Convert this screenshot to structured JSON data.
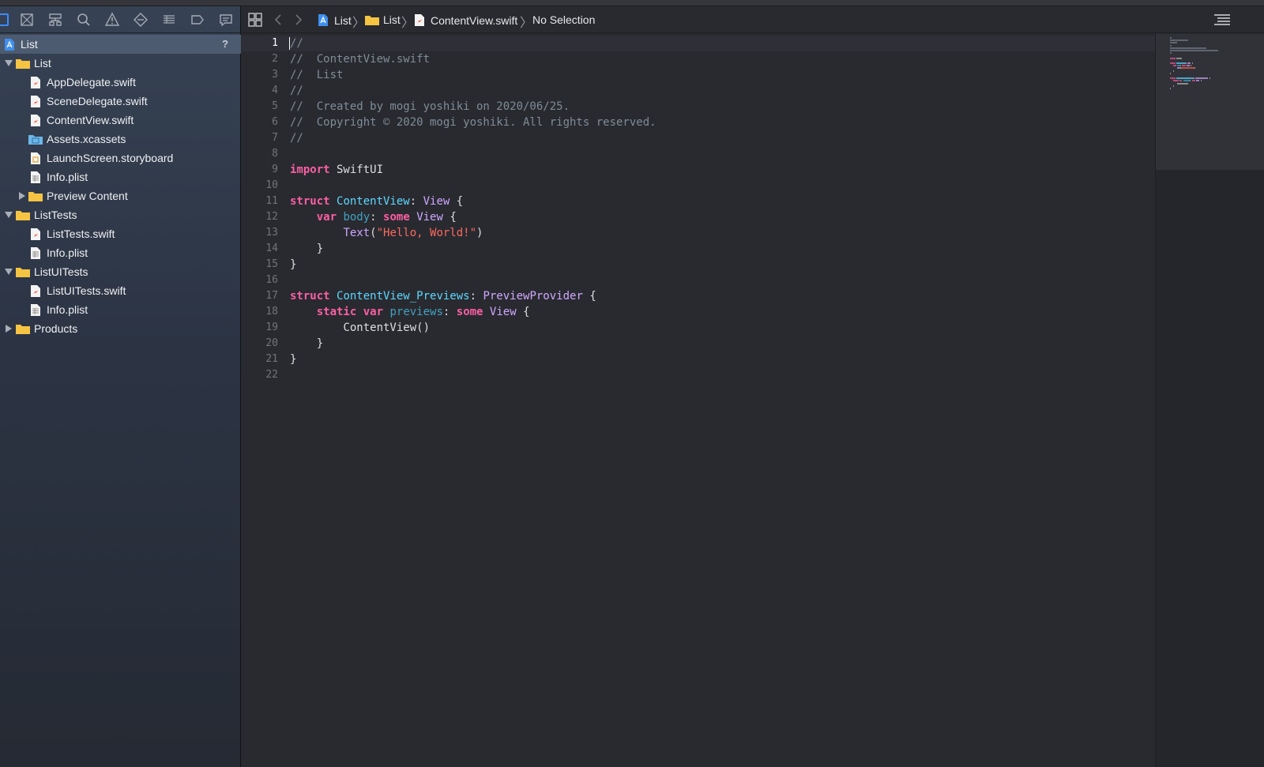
{
  "navigator": {
    "toolbar_icons": [
      "project-navigator-icon",
      "source-control-icon",
      "symbol-navigator-icon",
      "find-navigator-icon",
      "issue-navigator-icon",
      "test-navigator-icon",
      "debug-navigator-icon",
      "breakpoint-navigator-icon",
      "report-navigator-icon"
    ],
    "root": {
      "label": "List",
      "badge": "?"
    },
    "tree": [
      {
        "label": "List",
        "kind": "folder",
        "expanded": true
      },
      {
        "label": "AppDelegate.swift",
        "kind": "swift"
      },
      {
        "label": "SceneDelegate.swift",
        "kind": "swift"
      },
      {
        "label": "ContentView.swift",
        "kind": "swift"
      },
      {
        "label": "Assets.xcassets",
        "kind": "assets"
      },
      {
        "label": "LaunchScreen.storyboard",
        "kind": "storyboard"
      },
      {
        "label": "Info.plist",
        "kind": "plist"
      },
      {
        "label": "Preview Content",
        "kind": "folder",
        "expanded": false
      },
      {
        "label": "ListTests",
        "kind": "folder",
        "expanded": true
      },
      {
        "label": "ListTests.swift",
        "kind": "swift"
      },
      {
        "label": "Info.plist",
        "kind": "plist"
      },
      {
        "label": "ListUITests",
        "kind": "folder",
        "expanded": true
      },
      {
        "label": "ListUITests.swift",
        "kind": "swift"
      },
      {
        "label": "Info.plist",
        "kind": "plist"
      },
      {
        "label": "Products",
        "kind": "folder",
        "expanded": false
      }
    ]
  },
  "jumpbar": {
    "crumbs": [
      "List",
      "List",
      "ContentView.swift",
      "No Selection"
    ]
  },
  "editor": {
    "current_line": 1,
    "lines": [
      [
        [
          "comment",
          "//"
        ]
      ],
      [
        [
          "comment",
          "//  ContentView.swift"
        ]
      ],
      [
        [
          "comment",
          "//  List"
        ]
      ],
      [
        [
          "comment",
          "//"
        ]
      ],
      [
        [
          "comment",
          "//  Created by mogi yoshiki on 2020/06/25."
        ]
      ],
      [
        [
          "comment",
          "//  Copyright © 2020 mogi yoshiki. All rights reserved."
        ]
      ],
      [
        [
          "comment",
          "//"
        ]
      ],
      [],
      [
        [
          "kw",
          "import"
        ],
        [
          "plain",
          " SwiftUI"
        ]
      ],
      [],
      [
        [
          "kw",
          "struct"
        ],
        [
          "plain",
          " "
        ],
        [
          "decl",
          "ContentView"
        ],
        [
          "plain",
          ": "
        ],
        [
          "type",
          "View"
        ],
        [
          "plain",
          " {"
        ]
      ],
      [
        [
          "plain",
          "    "
        ],
        [
          "kw",
          "var"
        ],
        [
          "plain",
          " "
        ],
        [
          "prop",
          "body"
        ],
        [
          "plain",
          ": "
        ],
        [
          "kw",
          "some"
        ],
        [
          "plain",
          " "
        ],
        [
          "type",
          "View"
        ],
        [
          "plain",
          " {"
        ]
      ],
      [
        [
          "plain",
          "        "
        ],
        [
          "type",
          "Text"
        ],
        [
          "plain",
          "("
        ],
        [
          "str",
          "\"Hello, World!\""
        ],
        [
          "plain",
          ")"
        ]
      ],
      [
        [
          "plain",
          "    }"
        ]
      ],
      [
        [
          "plain",
          "}"
        ]
      ],
      [],
      [
        [
          "kw",
          "struct"
        ],
        [
          "plain",
          " "
        ],
        [
          "decl",
          "ContentView_Previews"
        ],
        [
          "plain",
          ": "
        ],
        [
          "type",
          "PreviewProvider"
        ],
        [
          "plain",
          " {"
        ]
      ],
      [
        [
          "plain",
          "    "
        ],
        [
          "kw",
          "static"
        ],
        [
          "plain",
          " "
        ],
        [
          "kw",
          "var"
        ],
        [
          "plain",
          " "
        ],
        [
          "prop",
          "previews"
        ],
        [
          "plain",
          ": "
        ],
        [
          "kw",
          "some"
        ],
        [
          "plain",
          " "
        ],
        [
          "type",
          "View"
        ],
        [
          "plain",
          " {"
        ]
      ],
      [
        [
          "plain",
          "        ContentView()"
        ]
      ],
      [
        [
          "plain",
          "    }"
        ]
      ],
      [
        [
          "plain",
          "}"
        ]
      ],
      []
    ]
  },
  "colors": {
    "editor_bg": "#292a30",
    "keyword": "#fc5fa3",
    "type": "#d0a8ff",
    "declaration": "#5dd8ff",
    "property": "#41a1c0",
    "string": "#fc6a5d",
    "comment": "#7f8c98",
    "selection_row": "#4d5b70"
  }
}
